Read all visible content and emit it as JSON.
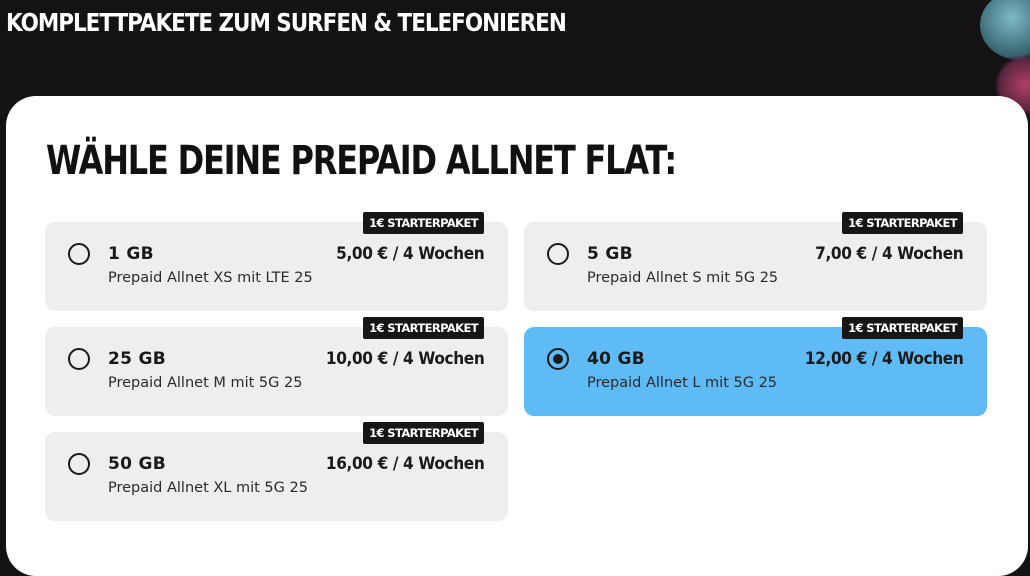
{
  "header": {
    "title": "KOMPLETTPAKETE ZUM SURFEN & TELEFONIEREN"
  },
  "panel": {
    "title": "WÄHLE DEINE PREPAID ALLNET FLAT:"
  },
  "colors": {
    "background": "#141213",
    "panel": "#ffffff",
    "card": "#eeeeee",
    "card_selected": "#5fbbf5",
    "badge": "#161616"
  },
  "plans": [
    {
      "badge": "1€ STARTERPAKET",
      "data": "1 GB",
      "price": "5,00 € / 4 Wochen",
      "name": "Prepaid Allnet XS mit LTE 25",
      "selected": false
    },
    {
      "badge": "1€ STARTERPAKET",
      "data": "5 GB",
      "price": "7,00 € / 4 Wochen",
      "name": "Prepaid Allnet S mit 5G 25",
      "selected": false
    },
    {
      "badge": "1€ STARTERPAKET",
      "data": "25 GB",
      "price": "10,00 € / 4 Wochen",
      "name": "Prepaid Allnet M mit 5G 25",
      "selected": false
    },
    {
      "badge": "1€ STARTERPAKET",
      "data": "40 GB",
      "price": "12,00 € / 4 Wochen",
      "name": "Prepaid Allnet L mit 5G 25",
      "selected": true
    },
    {
      "badge": "1€ STARTERPAKET",
      "data": "50 GB",
      "price": "16,00 € / 4 Wochen",
      "name": "Prepaid Allnet XL mit 5G 25",
      "selected": false
    }
  ]
}
